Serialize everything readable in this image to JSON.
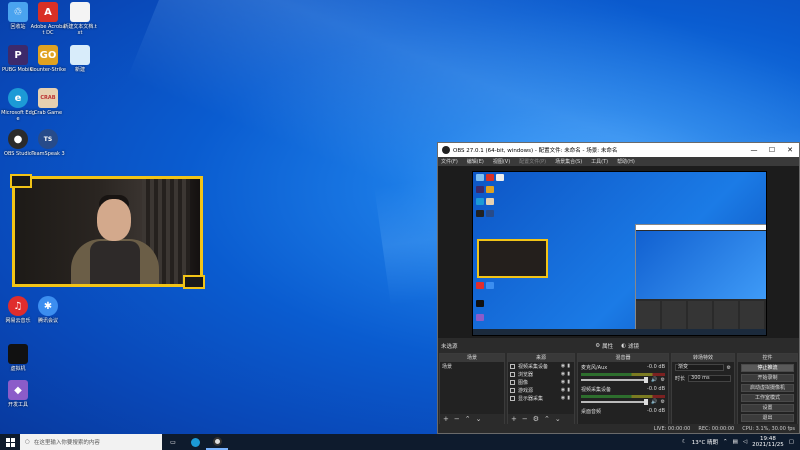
{
  "desktop": {
    "icons": [
      {
        "label": "回收站",
        "glyph": "♲",
        "color": "#4aa3ef"
      },
      {
        "label": "Adobe Acrobat DC",
        "glyph": "A",
        "color": "#d93025"
      },
      {
        "label": "新建文本文档.txt",
        "glyph": "",
        "color": "#f4f4f4"
      },
      {
        "label": "PUBG Mobile",
        "glyph": "P",
        "color": "#3d2a6b"
      },
      {
        "label": "Counter-Strike",
        "glyph": "GO",
        "color": "#e0a221"
      },
      {
        "label": "新建",
        "glyph": "",
        "color": "#d8ecfa"
      },
      {
        "label": "Microsoft Edge",
        "glyph": "e",
        "color": "#1c9ad6"
      },
      {
        "label": "Crab Game",
        "glyph": "CRAB",
        "color": "#e6d0b0"
      },
      {
        "label": "OBS Studio",
        "glyph": "●",
        "color": "#2b2b2b"
      },
      {
        "label": "TeamSpeak 3",
        "glyph": "TS",
        "color": "#274b8a"
      },
      {
        "label": "网易云音乐",
        "glyph": "♫",
        "color": "#e02d2d"
      },
      {
        "label": "腾讯会议",
        "glyph": "✱",
        "color": "#3c8ef0"
      },
      {
        "label": "虚拟机",
        "glyph": "",
        "color": "#111111"
      },
      {
        "label": "开发工具",
        "glyph": "◆",
        "color": "#8b5cc9"
      }
    ]
  },
  "obs": {
    "title": "OBS 27.0.1 (64-bit, windows) - 配置文件: 未命名 - 场景: 未命名",
    "menu": [
      "文件(F)",
      "编辑(E)",
      "视图(V)",
      "配置文件(P)",
      "场景集合(S)",
      "工具(T)",
      "帮助(H)"
    ],
    "no_source": "未选源",
    "props_label": "属性",
    "filters_label": "滤镜",
    "docks": {
      "scenes": {
        "title": "场景",
        "items": [
          "场景"
        ]
      },
      "sources": {
        "title": "来源",
        "items": [
          "视频采集设备",
          "浏览器",
          "图像",
          "游戏源",
          "显示器采集"
        ]
      },
      "mixer": {
        "title": "混音器",
        "channels": [
          {
            "name": "麦克风/Aux",
            "db": "-0.0 dB"
          },
          {
            "name": "视频采集设备",
            "db": "-0.0 dB"
          },
          {
            "name": "桌面音频",
            "db": "-0.0 dB"
          }
        ]
      },
      "transitions": {
        "title": "转场特效",
        "type": "渐变",
        "duration_label": "时长",
        "duration": "300 ms"
      },
      "controls": {
        "title": "控件",
        "buttons": [
          "停止推流",
          "开始录制",
          "启动虚拟摄像机",
          "工作室模式",
          "设置",
          "退出"
        ]
      }
    },
    "status": {
      "live": "LIVE: 00:00:00",
      "rec": "REC: 00:00:00",
      "cpu": "CPU: 3.1%, 30.00 fps"
    }
  },
  "taskbar": {
    "search_placeholder": "在这里输入你要搜索的内容",
    "weather": "13°C 晴朗",
    "time": "19:48",
    "date": "2021/11/25"
  }
}
